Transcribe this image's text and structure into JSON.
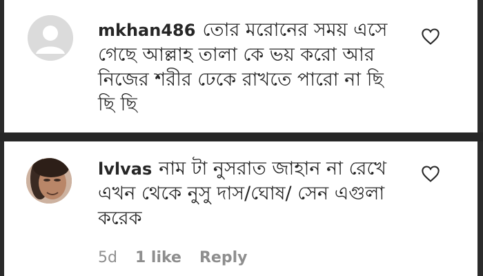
{
  "comments": [
    {
      "username": "mkhan486",
      "text": "তোর মরোনের সময় এসে গেছে আল্লাহ তালা কে ভয় করো আর নিজের শরীর ঢেকে রাখতে পারো না ছি ছি ছি",
      "avatar": "default-avatar-icon"
    },
    {
      "username": "lvlvas",
      "text": "নাম টা নুসরাত জাহান না রেখে এখন থেকে নুসু দাস/ঘোষ/ সেন এগুলা করেক",
      "avatar": "profile-photo",
      "time": "5d",
      "likes": "1 like",
      "reply": "Reply"
    }
  ],
  "colors": {
    "text": "#262626",
    "meta": "#8e8e8e",
    "background": "#ffffff"
  }
}
